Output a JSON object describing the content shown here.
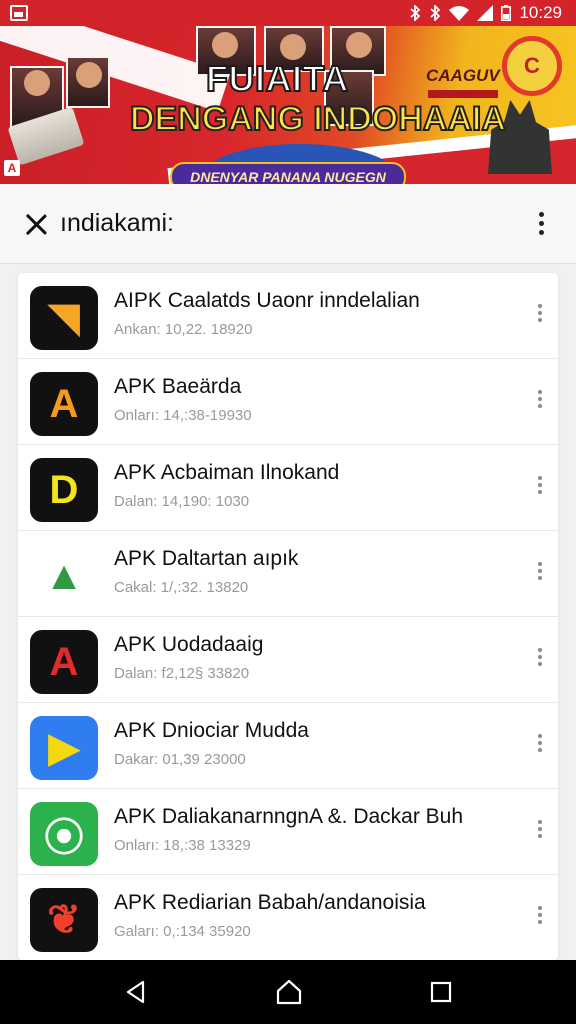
{
  "status_bar": {
    "time": "10:29",
    "icons": [
      "bluetooth-icon",
      "vibrate-icon",
      "wifi-icon",
      "signal-icon",
      "battery-icon"
    ]
  },
  "banner": {
    "title_line1": "FUIAITA",
    "title_line2": "DENGANG INDOHAAIA",
    "subtitle": "DNENYAR PANANA NUGEGN",
    "brand": "CAAGUV",
    "logo_text": "C",
    "corner_logo": "A"
  },
  "search": {
    "query": "ındiakami:"
  },
  "apps": [
    {
      "title": "AIPK Caalatds Uaonr inndelalian",
      "meta": "Ankan: 10,22. 18920",
      "icon": "rocket-icon",
      "bg": "#111111",
      "fg": "#f6a623",
      "glyph": "◥"
    },
    {
      "title": "APK Baeärda",
      "meta": "Onları: 14,:38-19930",
      "icon": "a-apk-icon",
      "bg": "#111111",
      "fg": "#f59a1b",
      "glyph": "A"
    },
    {
      "title": "APK Acbaiman Ilnokand",
      "meta": "Dalan: 14,190: 1030",
      "icon": "yellow-d-icon",
      "bg": "#111111",
      "fg": "#f4e41b",
      "glyph": "D"
    },
    {
      "title": "APK Daltartan aıpık",
      "meta": "Cakal: 1/,:32. 13820",
      "icon": "triangle-drive-icon",
      "bg": "#ffffff",
      "fg": "#2f9a3f",
      "glyph": "▲"
    },
    {
      "title": "APK Uodadaaig",
      "meta": "Dalan: f2,12§ 33820",
      "icon": "red-a-icon",
      "bg": "#111111",
      "fg": "#e32b2b",
      "glyph": "A"
    },
    {
      "title": "APK Dniociar Mudda",
      "meta": "Dakar: 01,39 23000",
      "icon": "play-arrow-icon",
      "bg": "#2f7df0",
      "fg": "#f5d90f",
      "glyph": "▶"
    },
    {
      "title": "APK DaliakanarnngnA &. Dackar Buh",
      "meta": "Onları: 18,:38 13329",
      "icon": "green-pin-icon",
      "bg": "#2bb24c",
      "fg": "#ffffff",
      "glyph": "⦿"
    },
    {
      "title": "APK Rediarian Babah/andanoisia",
      "meta": "Gaları: 0,:134 35920",
      "icon": "red-bird-icon",
      "bg": "#111111",
      "fg": "#f1402c",
      "glyph": "❦"
    }
  ],
  "navbar": {
    "back": "back-icon",
    "home": "home-icon",
    "recents": "recents-icon"
  }
}
